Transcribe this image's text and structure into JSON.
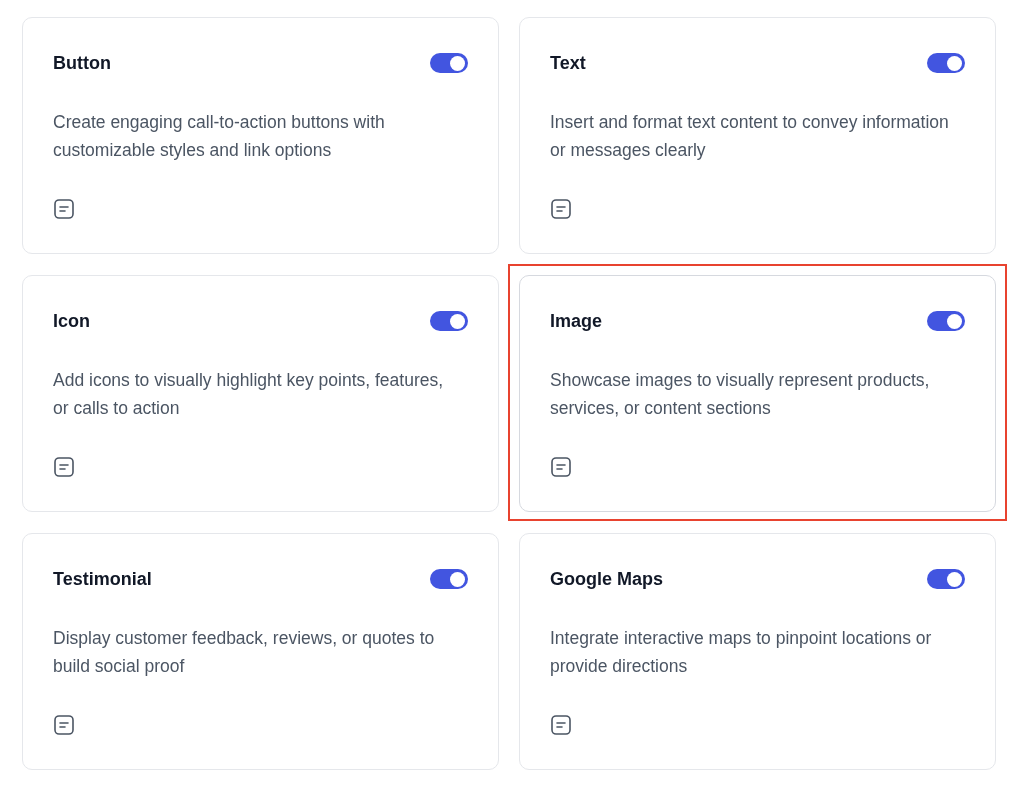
{
  "cards": [
    {
      "title": "Button",
      "on": true,
      "highlighted": false,
      "description": "Create engaging call-to-action buttons with customizable styles and link options"
    },
    {
      "title": "Text",
      "on": true,
      "highlighted": false,
      "description": "Insert and format text content to convey information or messages clearly"
    },
    {
      "title": "Icon",
      "on": true,
      "highlighted": false,
      "description": "Add icons to visually highlight key points, features, or calls to action"
    },
    {
      "title": "Image",
      "on": true,
      "highlighted": true,
      "description": "Showcase images to visually represent products, services, or content sections"
    },
    {
      "title": "Testimonial",
      "on": true,
      "highlighted": false,
      "description": "Display customer feedback, reviews, or quotes to build social proof"
    },
    {
      "title": "Google Maps",
      "on": true,
      "highlighted": false,
      "description": "Integrate interactive maps to pinpoint locations or provide directions"
    }
  ]
}
